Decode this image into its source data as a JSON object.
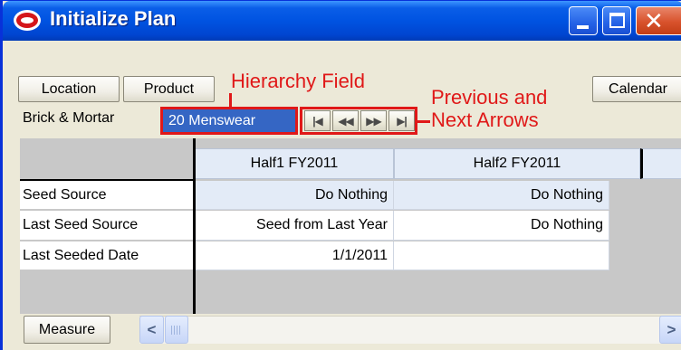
{
  "window": {
    "title": "Initialize Plan"
  },
  "toolbar": {
    "location_label": "Location",
    "product_label": "Product",
    "calendar_label": "Calendar"
  },
  "filter": {
    "location_value": "Brick & Mortar",
    "hierarchy_value": "20 Menswear"
  },
  "nav": {
    "first": "|◀",
    "prev": "◀◀",
    "next": "▶▶",
    "last": "▶|"
  },
  "annotations": {
    "hierarchy_field": "Hierarchy Field",
    "arrows_line1": "Previous and",
    "arrows_line2": "Next Arrows"
  },
  "grid": {
    "columns": [
      "Half1 FY2011",
      "Half2 FY2011"
    ],
    "rows": [
      {
        "label": "Seed Source",
        "values": [
          "Do Nothing",
          "Do Nothing"
        ]
      },
      {
        "label": "Last Seed Source",
        "values": [
          "Seed from Last Year",
          "Do Nothing"
        ]
      },
      {
        "label": "Last Seeded Date",
        "values": [
          "1/1/2011",
          ""
        ]
      }
    ]
  },
  "footer": {
    "measure_label": "Measure"
  },
  "colors": {
    "annotation_red": "#e01818",
    "selected_field_blue": "#3566c4",
    "header_cell_blue": "#e3ebf7"
  },
  "icons": {
    "app": "oracle-ring-icon",
    "minimize": "minimize-icon",
    "maximize": "maximize-icon",
    "close": "close-icon",
    "scroll_left": "chevron-left-icon",
    "scroll_right": "chevron-right-icon"
  }
}
